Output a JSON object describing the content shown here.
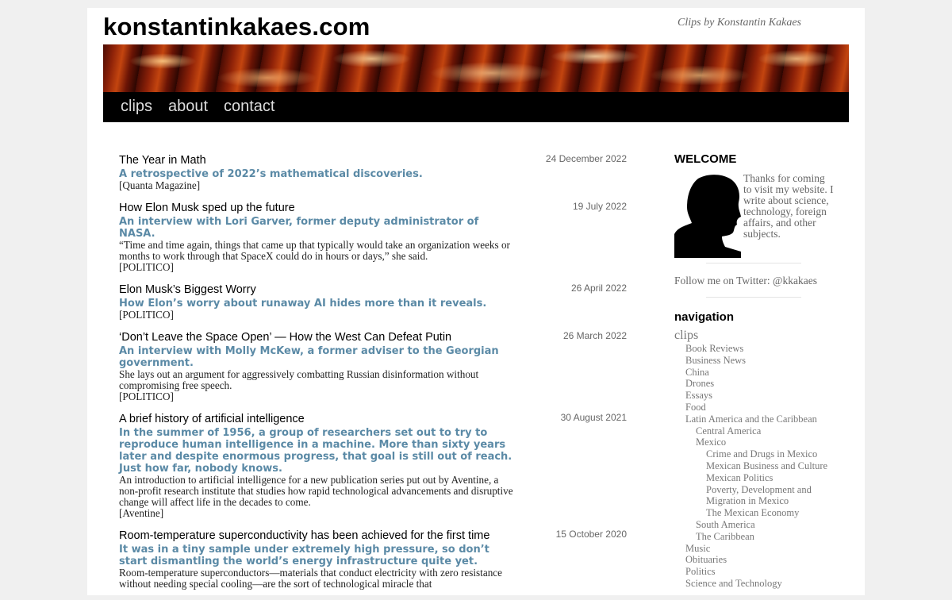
{
  "header": {
    "site_title": "konstantinkakaes.com",
    "tagline": "Clips by Konstantin Kakaes"
  },
  "nav": [
    "clips",
    "about",
    "contact"
  ],
  "posts": [
    {
      "title": "The Year in Math",
      "date": "24 December 2022",
      "subtitle": "A retrospective of 2022’s mathematical discoveries.",
      "description": "",
      "source": "[Quanta Magazine]"
    },
    {
      "title": "How Elon Musk sped up the future",
      "date": "19 July 2022",
      "subtitle": "An interview with Lori Garver, former deputy administrator of NASA.",
      "description": "“Time and time again, things that came up that typically would take an organization weeks or months to work through that SpaceX could do in hours or days,” she said.",
      "source": "[POLITICO]"
    },
    {
      "title": "Elon Musk’s Biggest Worry",
      "date": "26 April 2022",
      "subtitle": "How Elon’s worry about runaway AI hides more than it reveals.",
      "description": "",
      "source": "[POLITICO]"
    },
    {
      "title": "‘Don’t Leave the Space Open’ — How the West Can Defeat Putin",
      "date": "26 March 2022",
      "subtitle": "An interview with Molly McKew, a former adviser to the Georgian government.",
      "description": "She lays out an argument for aggressively combatting Russian disinformation without compromising free speech.",
      "source": "[POLITICO]"
    },
    {
      "title": "A brief history of artificial intelligence",
      "date": "30 August 2021",
      "subtitle": "In the summer of 1956, a group of researchers set out to try to reproduce human intelligence in a machine. More than sixty years later and despite enormous progress, that goal is still out of reach. Just how far, nobody knows.",
      "description": "An introduction to artificial intelligence for a new publication series put out by Aventine, a non-profit research institute that studies how rapid technological advancements and disruptive change will affect life in the decades to come.",
      "source": "[Aventine]"
    },
    {
      "title": "Room-temperature superconductivity has been achieved for the first time",
      "date": "15 October 2020",
      "subtitle": "It was in a tiny sample under extremely high pressure, so don’t start dismantling the world’s energy infrastructure quite yet.",
      "description": "Room-temperature superconductors—materials that conduct electricity with zero resistance without needing special cooling—are the sort of technological miracle that",
      "source": ""
    }
  ],
  "sidebar": {
    "welcome_heading": "WELCOME",
    "welcome_text": "Thanks for coming to visit my website. I write about science, technology, foreign affairs, and other subjects.",
    "twitter_text": "Follow me on Twitter: @kkakaes",
    "nav_heading": "navigation",
    "nav_items": [
      {
        "label": "clips",
        "level": 0
      },
      {
        "label": "Book Reviews",
        "level": 1
      },
      {
        "label": "Business News",
        "level": 1
      },
      {
        "label": "China",
        "level": 1
      },
      {
        "label": "Drones",
        "level": 1
      },
      {
        "label": "Essays",
        "level": 1
      },
      {
        "label": "Food",
        "level": 1
      },
      {
        "label": "Latin America and the Caribbean",
        "level": 1
      },
      {
        "label": "Central America",
        "level": 2
      },
      {
        "label": "Mexico",
        "level": 2
      },
      {
        "label": "Crime and Drugs in Mexico",
        "level": 3
      },
      {
        "label": "Mexican Business and Culture",
        "level": 3
      },
      {
        "label": "Mexican Politics",
        "level": 3
      },
      {
        "label": "Poverty, Development and Migration in Mexico",
        "level": 3
      },
      {
        "label": "The Mexican Economy",
        "level": 3
      },
      {
        "label": "South America",
        "level": 2
      },
      {
        "label": "The Caribbean",
        "level": 2
      },
      {
        "label": "Music",
        "level": 1
      },
      {
        "label": "Obituaries",
        "level": 1
      },
      {
        "label": "Politics",
        "level": 1
      },
      {
        "label": "Science and Technology",
        "level": 1
      }
    ]
  },
  "colors": {
    "subtitle": "#5b8aa6",
    "navbar_bg": "#000000",
    "nav_text": "#dddddd",
    "sidebar_text": "#666666"
  }
}
